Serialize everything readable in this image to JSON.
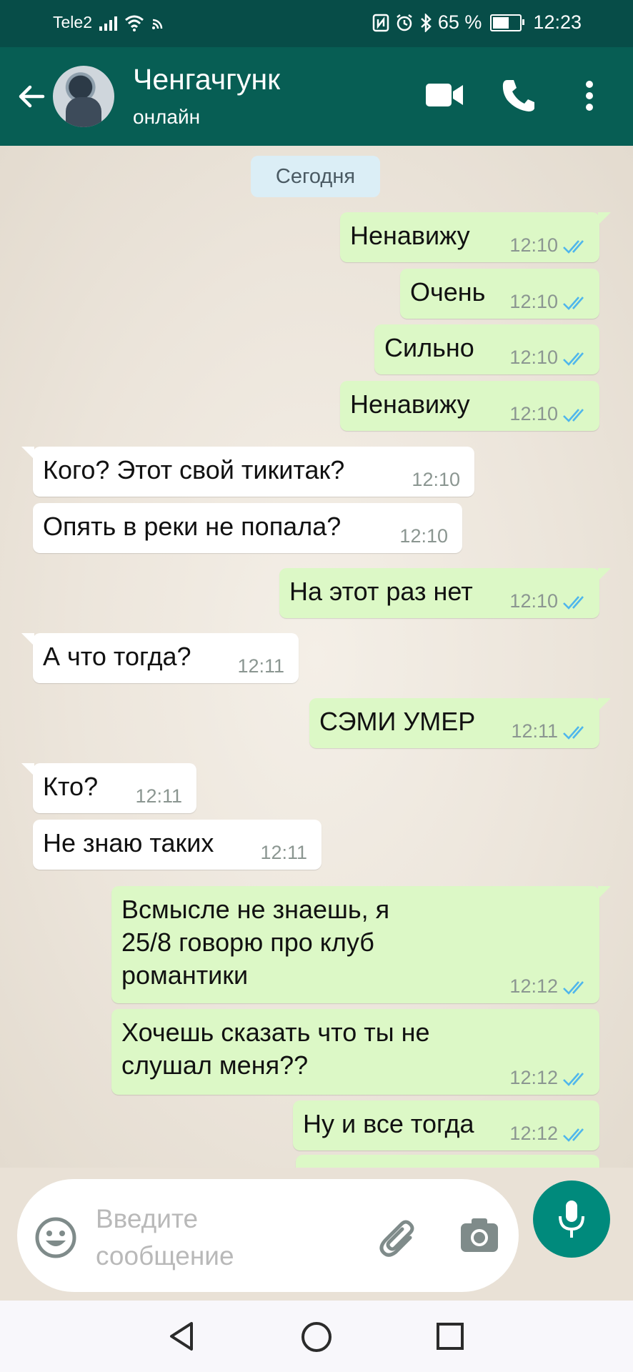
{
  "status_bar": {
    "carrier": "Tele2",
    "battery": "65 %",
    "battery_level": 0.65,
    "time": "12:23"
  },
  "header": {
    "contact_name": "Ченгачгунк",
    "status": "онлайн"
  },
  "chat": {
    "date_chip": "Сегодня",
    "messages": [
      {
        "dir": "out",
        "text": "Ненавижу",
        "time": "12:10"
      },
      {
        "dir": "out",
        "text": "Очень",
        "time": "12:10"
      },
      {
        "dir": "out",
        "text": "Сильно",
        "time": "12:10"
      },
      {
        "dir": "out",
        "text": "Ненавижу",
        "time": "12:10"
      },
      {
        "dir": "in",
        "text": "Кого? Этот свой тикитак?",
        "time": "12:10"
      },
      {
        "dir": "in",
        "text": "Опять в реки не попала?",
        "time": "12:10"
      },
      {
        "dir": "out",
        "text": "На этот раз нет",
        "time": "12:10"
      },
      {
        "dir": "in",
        "text": "А что тогда?",
        "time": "12:11"
      },
      {
        "dir": "out",
        "text": "СЭМИ УМЕР",
        "time": "12:11"
      },
      {
        "dir": "in",
        "text": "Кто?",
        "time": "12:11"
      },
      {
        "dir": "in",
        "text": "Не знаю таких",
        "time": "12:11"
      },
      {
        "dir": "out",
        "text": "Всмысле не знаешь, я\n25/8 говорю про клуб\nромантики",
        "time": "12:12"
      },
      {
        "dir": "out",
        "text": "Хочешь сказать что ты не\nслушал меня??",
        "time": "12:12"
      },
      {
        "dir": "out",
        "text": "Ну и все тогда",
        "time": "12:12"
      }
    ]
  },
  "input": {
    "placeholder": "Введите\nсообщение"
  },
  "colors": {
    "header": "#075e54",
    "status_bar": "#074d48",
    "outgoing_bubble": "#dcf8c6",
    "incoming_bubble": "#ffffff",
    "read_ticks": "#4fb6ec",
    "mic_button": "#008a7c"
  },
  "icons": [
    "back-arrow-icon",
    "video-call-icon",
    "phone-icon",
    "more-vert-icon",
    "emoji-icon",
    "attach-icon",
    "camera-icon",
    "mic-icon",
    "nav-back-icon",
    "nav-home-icon",
    "nav-recents-icon"
  ]
}
